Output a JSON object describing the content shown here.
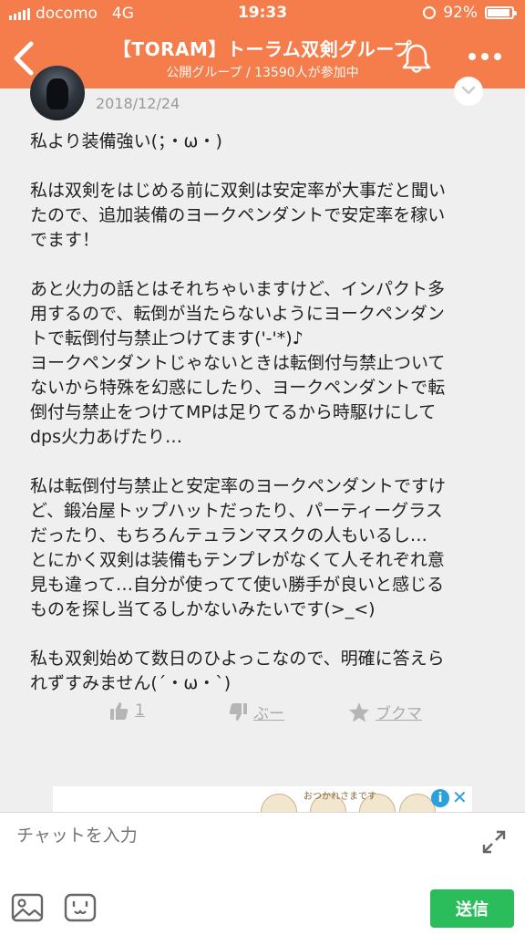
{
  "status_bar": {
    "carrier": "docomo",
    "network": "4G",
    "time": "19:33",
    "battery": "92%",
    "battery_level": 0.92
  },
  "header": {
    "title": "【TORAM】トーラム双剣グループ",
    "subtitle": "公開グループ / 13590人が参加中",
    "back_icon": "chevron-left-icon",
    "bell_icon": "bell-icon",
    "more_icon": "more-dots-icon",
    "color": "#f57c4b"
  },
  "message": {
    "date": "2018/12/24",
    "paragraphs": [
      [
        "私より装備強い(；・ω・)"
      ],
      [
        "私は双剣をはじめる前に双剣は安定率が大事だと聞い",
        "たので、追加装備のヨークペンダントで安定率を稼い",
        "でます！"
      ],
      [
        "あと火力の話とはそれちゃいますけど、インパクト多",
        "用するので、転倒が当たらないようにヨークペンダン",
        "トで転倒付与禁止つけてます('-'*)♪",
        "ヨークペンダントじゃないときは転倒付与禁止ついて",
        "ないから特殊を幻惑にしたり、ヨークペンダントで転",
        "倒付与禁止をつけてMPは足りてるから時駆けにして",
        "dps火力あげたり…"
      ],
      [
        "私は転倒付与禁止と安定率のヨークペンダントですけ",
        "ど、鍛冶屋トップハットだったり、パーティーグラス",
        "だったり、もちろんテュランマスクの人もいるし…",
        "とにかく双剣は装備もテンプレがなくて人それぞれ意",
        "見も違って…自分が使ってて使い勝手が良いと感じる",
        "ものを探し当てるしかないみたいです(>_<)"
      ],
      [
        "私も双剣始めて数日のひよっこなので、明確に答えら",
        "れずすみません(´・ω・`)"
      ]
    ]
  },
  "reactions": {
    "like_count": "1",
    "dislike_label": "ぶー",
    "bookmark_label": "ブクマ"
  },
  "ad": {
    "text": "おつかれさまです"
  },
  "input": {
    "placeholder": "チャットを入力",
    "send_label": "送信",
    "send_color": "#2bbd5c"
  }
}
